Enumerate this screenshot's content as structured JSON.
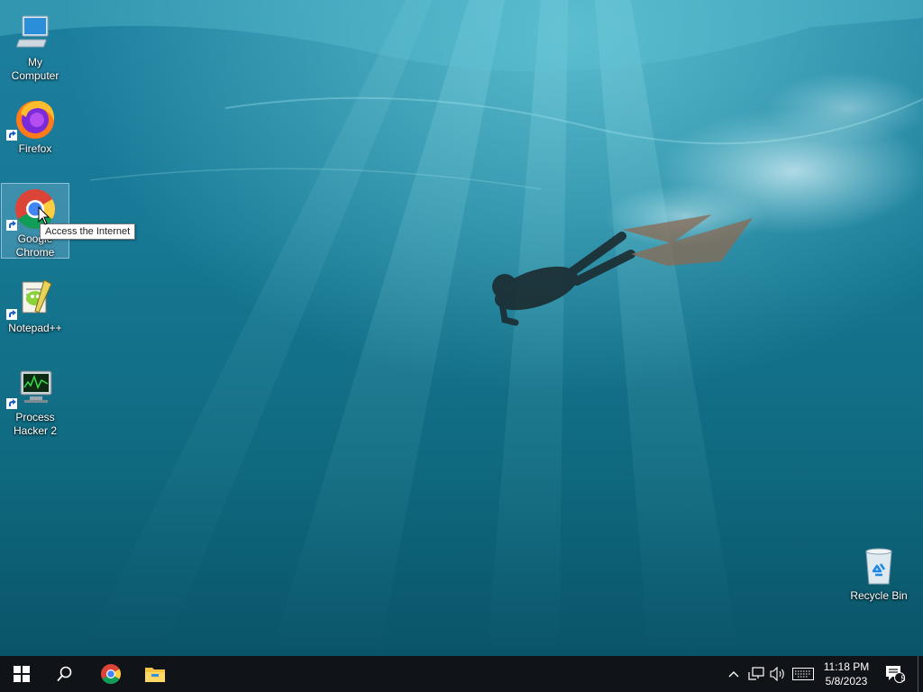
{
  "desktop": {
    "icons": [
      {
        "label": "My Computer",
        "icon": "computer-icon",
        "shortcut": false
      },
      {
        "label": "Firefox",
        "icon": "firefox-icon",
        "shortcut": true
      },
      {
        "label": "Google Chrome",
        "icon": "chrome-icon",
        "shortcut": true,
        "selected": true
      },
      {
        "label": "Notepad++",
        "icon": "notepad-plus-plus-icon",
        "shortcut": true
      },
      {
        "label": "Process Hacker 2",
        "icon": "process-hacker-icon",
        "shortcut": true
      }
    ],
    "recycle_bin": {
      "label": "Recycle Bin",
      "icon": "recycle-bin-icon"
    },
    "tooltip": "Access the Internet",
    "wallpaper": "underwater-freediver"
  },
  "taskbar": {
    "start": {
      "icon": "windows-start-icon"
    },
    "search": {
      "icon": "search-icon"
    },
    "pinned": [
      {
        "name": "Google Chrome",
        "icon": "chrome-icon"
      },
      {
        "name": "File Explorer",
        "icon": "folder-icon"
      }
    ],
    "tray": {
      "icons": [
        "chevron-up-icon",
        "network-icon",
        "volume-icon",
        "keyboard-icon"
      ],
      "time": "11:18 PM",
      "date": "5/8/2023",
      "notifications_count": "5"
    }
  },
  "colors": {
    "taskbar": "#101418",
    "water_deep": "#0a5f7a",
    "water_light": "#39b3c8"
  }
}
